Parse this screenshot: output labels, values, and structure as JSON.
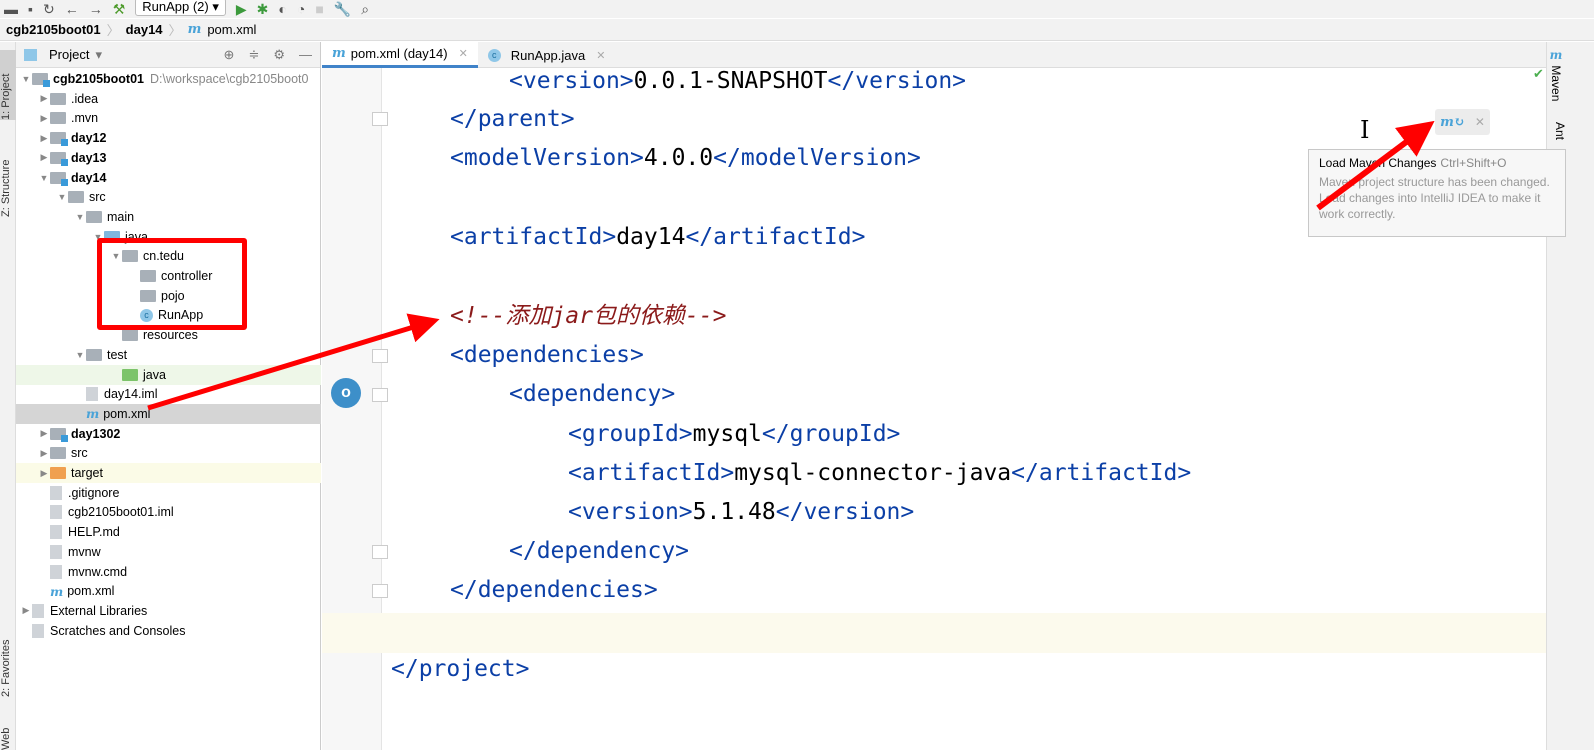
{
  "toolbar": {
    "run_config": "RunApp (2)"
  },
  "breadcrumb": [
    "cgb2105boot01",
    "day14",
    "pom.xml"
  ],
  "left_strip": {
    "project": "1: Project",
    "structure": "Z: Structure",
    "favorites": "2: Favorites",
    "web": "Web"
  },
  "panel": {
    "title": "Project"
  },
  "tree": [
    {
      "label": "cgb2105boot01",
      "path": "D:\\workspace\\cgb2105boot0"
    },
    {
      "label": ".idea"
    },
    {
      "label": ".mvn"
    },
    {
      "label": "day12"
    },
    {
      "label": "day13"
    },
    {
      "label": "day14"
    },
    {
      "label": "src"
    },
    {
      "label": "main"
    },
    {
      "label": "java"
    },
    {
      "label": "cn.tedu"
    },
    {
      "label": "controller"
    },
    {
      "label": "pojo"
    },
    {
      "label": "RunApp"
    },
    {
      "label": "resources"
    },
    {
      "label": "test"
    },
    {
      "label": "java"
    },
    {
      "label": "day14.iml"
    },
    {
      "label": "pom.xml"
    },
    {
      "label": "day1302"
    },
    {
      "label": "src"
    },
    {
      "label": "target"
    },
    {
      "label": ".gitignore"
    },
    {
      "label": "cgb2105boot01.iml"
    },
    {
      "label": "HELP.md"
    },
    {
      "label": "mvnw"
    },
    {
      "label": "mvnw.cmd"
    },
    {
      "label": "pom.xml"
    },
    {
      "label": "External Libraries"
    },
    {
      "label": "Scratches and Consoles"
    }
  ],
  "tabs": [
    {
      "label": "pom.xml (day14)",
      "active": true
    },
    {
      "label": "RunApp.java"
    }
  ],
  "code": {
    "l1": {
      "open": "version",
      "text": "0.0.1-SNAPSHOT"
    },
    "l2": "</parent>",
    "l3": {
      "open": "modelVersion",
      "text": "4.0.0"
    },
    "l4": {
      "open": "artifactId",
      "text": "day14"
    },
    "comment": "<!--添加jar包的依赖-->",
    "l5": "<dependencies>",
    "l6": "<dependency>",
    "l7": {
      "open": "groupId",
      "text": "mysql"
    },
    "l8": {
      "open": "artifactId",
      "text": "mysql-connector-java"
    },
    "l9": {
      "open": "version",
      "text": "5.1.48"
    },
    "l10": "</dependency>",
    "l11": "</dependencies>",
    "l12": "</project>"
  },
  "right_strip": {
    "maven": "Maven",
    "ant": "Ant"
  },
  "tooltip": {
    "title": "Load Maven Changes",
    "shortcut": "Ctrl+Shift+O",
    "body": "Maven project structure has been changed. Load changes into IntelliJ IDEA to make it work correctly."
  },
  "colors": {
    "annotation_red": "#ff0000",
    "tag_blue": "#0b3fa6",
    "comment": "#8b1a1a"
  }
}
